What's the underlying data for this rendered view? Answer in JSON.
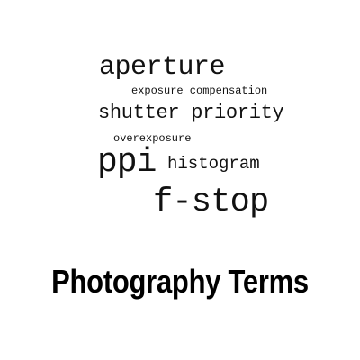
{
  "word_cloud": {
    "words": [
      "aperture",
      "exposure compensation",
      "shutter priority",
      "overexposure",
      "ppi",
      "histogram",
      "f-stop"
    ]
  },
  "caption": {
    "title": "Photography Terms"
  },
  "colors": {
    "background": "#ffffff",
    "text": "#111111"
  }
}
